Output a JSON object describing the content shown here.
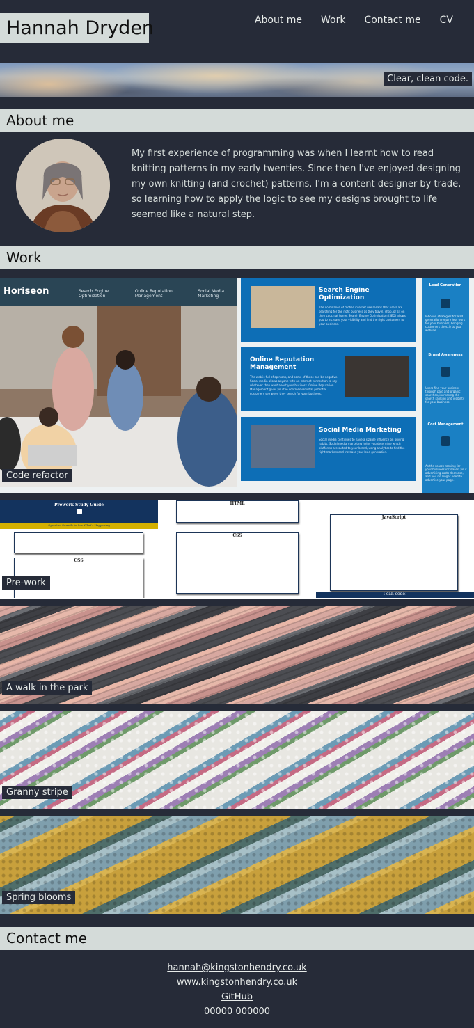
{
  "header": {
    "name": "Hannah Dryden",
    "nav": [
      "About me",
      "Work",
      "Contact me",
      "CV"
    ]
  },
  "hero": {
    "tagline": "Clear, clean code."
  },
  "about": {
    "heading": "About me",
    "text": "My first experience of programming was when I learnt how to read knitting patterns in my early twenties. Since then I've enjoyed designing my own knitting (and crochet) patterns. I'm a content designer by trade, so learning how to apply the logic to see my designs brought to life seemed like a natural step."
  },
  "work": {
    "heading": "Work",
    "items": [
      {
        "label": "Code refactor"
      },
      {
        "label": "Pre-work"
      },
      {
        "label": "A walk in the park"
      },
      {
        "label": "Granny stripe"
      },
      {
        "label": "Spring blooms"
      }
    ],
    "horiseon": {
      "logo": "Horiseon",
      "nav": [
        "Search Engine Optimization",
        "Online Reputation Management",
        "Social Media Marketing"
      ],
      "cards": [
        {
          "title": "Search Engine Optimization",
          "body": "The dominance of mobile internet use means that users are searching for the right business as they travel, shop, or sit on their couch at home. Search Engine Optimization (SEO) allows you to increase your visibility and find the right customers for your business."
        },
        {
          "title": "Online Reputation Management",
          "body": "The web is full of opinions, and some of those can be negative. Social media allows anyone with an internet connection to say whatever they want about your business. Online Reputation Management gives you the control over what potential customers see when they search for your business."
        },
        {
          "title": "Social Media Marketing",
          "body": "Social media continues to have a sizable influence on buying habits. Social media marketing helps you determine which platforms are suited to your brand, using analytics to find the right markets and increase your lead generation."
        }
      ],
      "side": [
        {
          "title": "Lead Generation",
          "text": "Inbound strategies for lead generation require less work for your business, bringing customers directly to your website."
        },
        {
          "title": "Brand Awareness",
          "text": "Users find your business through paid and organic searches, increasing the search ranking and visibility for your business."
        },
        {
          "title": "Cost Management",
          "text": "As the search ranking for your business increases, your advertising costs decrease, and you no longer need to advertise your page."
        }
      ]
    },
    "prework": {
      "title": "Prework Study Guide",
      "subtitle": "Open the Console to See What's Happening",
      "html_heading": "HTML",
      "css_heading": "CSS",
      "js_heading": "JavaScript",
      "footer": "I can code!"
    }
  },
  "contact": {
    "heading": "Contact me",
    "email": "hannah@kingstonhendry.co.uk",
    "website": "www.kingstonhendry.co.uk",
    "github": "GitHub",
    "phone": "00000 000000"
  }
}
